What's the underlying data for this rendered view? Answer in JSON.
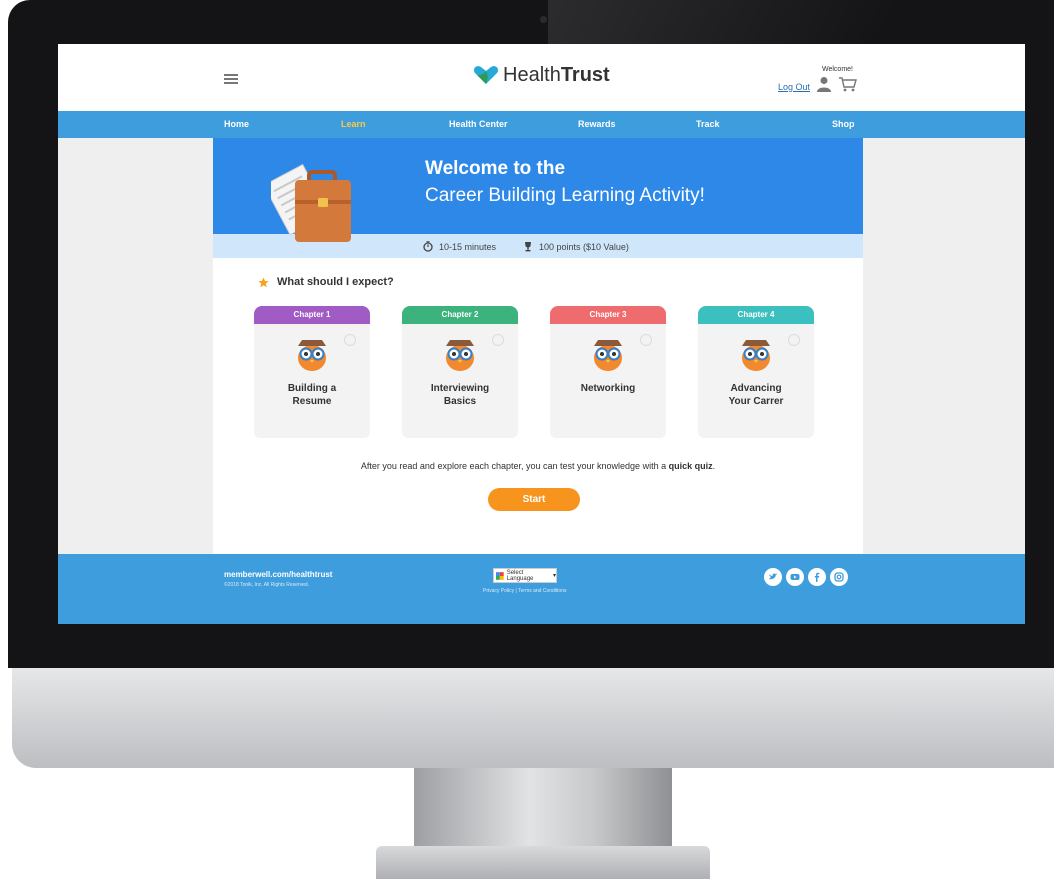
{
  "header": {
    "brand_prefix": "Health",
    "brand_bold": "Trust",
    "welcome": "Welcome!",
    "logout": "Log Out"
  },
  "nav": [
    "Home",
    "Learn",
    "Health Center",
    "Rewards",
    "Track",
    "Shop"
  ],
  "hero": {
    "title": "Welcome to the",
    "subtitle": "Career Building Learning Activity!",
    "duration": "10-15 minutes",
    "points": "100 points ($10 Value)"
  },
  "expect_heading": "What should I expect?",
  "chapters": [
    {
      "tab": "Chapter 1",
      "line1": "Building a",
      "line2": "Resume"
    },
    {
      "tab": "Chapter 2",
      "line1": "Interviewing",
      "line2": "Basics"
    },
    {
      "tab": "Chapter 3",
      "line1": "Networking",
      "line2": ""
    },
    {
      "tab": "Chapter 4",
      "line1": "Advancing",
      "line2": "Your Carrer"
    }
  ],
  "after_text": "After you read and explore each chapter, you can test your knowledge with a ",
  "after_bold": "quick quiz",
  "after_end": ".",
  "start_label": "Start",
  "footer": {
    "site": "memberwell.com/healthtrust",
    "copyright": "©2018 Tonik, Inc. All Rights Reserved.",
    "language": "Select Language",
    "privacy": "Privacy Policy",
    "terms": "Terms and Conditions"
  },
  "colors": {
    "nav": "#3e9ddd",
    "hero": "#2d88e8",
    "chapter1": "#a05bc4",
    "chapter2": "#3cb27d",
    "chapter3": "#ee6b6e",
    "chapter4": "#3cbfbf",
    "start": "#f7941d"
  },
  "icons": [
    "menu-icon",
    "heart-logo-icon",
    "user-icon",
    "cart-icon",
    "stopwatch-icon",
    "trophy-icon",
    "star-icon",
    "briefcase-icon",
    "owl-icon",
    "twitter-icon",
    "youtube-icon",
    "facebook-icon",
    "instagram-icon"
  ]
}
